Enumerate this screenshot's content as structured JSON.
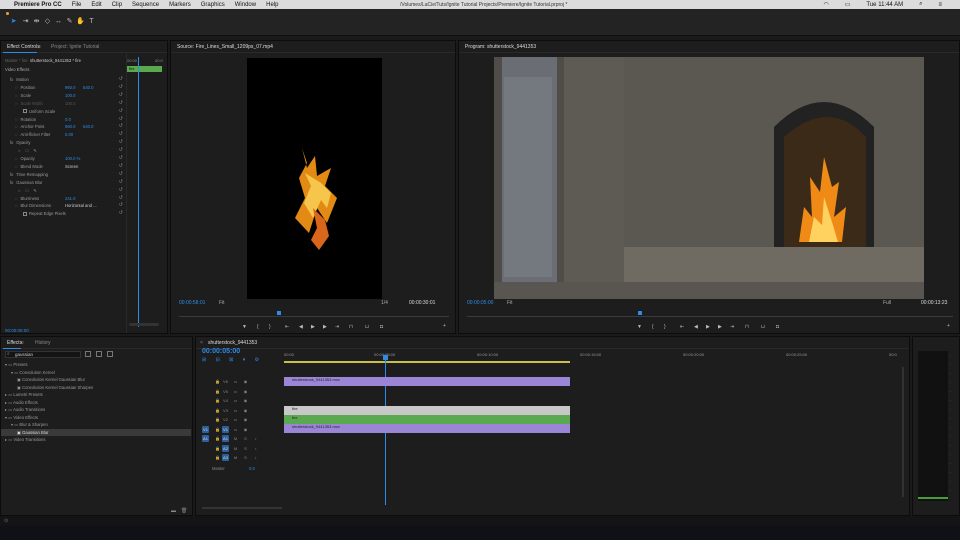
{
  "menubar": {
    "app_name": "Premiere Pro CC",
    "items": [
      "File",
      "Edit",
      "Clip",
      "Sequence",
      "Markers",
      "Graphics",
      "Window",
      "Help"
    ],
    "path": "/Volumes/LaCie/Tuts/Ignite Tutorial Projects/Premiere/Ignite Tutorial.prproj *",
    "clock": "Tue 11:44 AM"
  },
  "effect_controls": {
    "tab_active": "Effect Controls",
    "tab_project": "Project: Ignite Tutorial",
    "master": "Master * fire",
    "clip": "shutterstock_9441353 * fire",
    "ruler_start": "00:00",
    "ruler_end": "00:0",
    "clip_chip": "fire",
    "video_effects": "Video Effects",
    "rows": [
      {
        "label": "Motion",
        "indent": 1
      },
      {
        "label": "Position",
        "v1": "960.0",
        "v2": "540.0",
        "indent": 2
      },
      {
        "label": "Scale",
        "v1": "100.0",
        "indent": 2
      },
      {
        "label": "Scale Width",
        "v1": "100.0",
        "indent": 2,
        "dim": true
      },
      {
        "label": "Uniform Scale",
        "indent": 3,
        "checkbox": true
      },
      {
        "label": "Rotation",
        "v1": "0.0",
        "indent": 2
      },
      {
        "label": "Anchor Point",
        "v1": "960.0",
        "v2": "540.0",
        "indent": 2
      },
      {
        "label": "Anti-flicker Filter",
        "v1": "0.00",
        "indent": 2
      },
      {
        "label": "Opacity",
        "indent": 1
      },
      {
        "label": "",
        "indent": 2,
        "masks": true
      },
      {
        "label": "Opacity",
        "v1": "100.0 %",
        "indent": 2
      },
      {
        "label": "Blend Mode",
        "v1": "Screen",
        "indent": 2,
        "select": true
      },
      {
        "label": "Time Remapping",
        "indent": 1
      },
      {
        "label": "Gaussian Blur",
        "indent": 1
      },
      {
        "label": "",
        "indent": 2,
        "masks": true
      },
      {
        "label": "Blurriness",
        "v1": "241.0",
        "indent": 2
      },
      {
        "label": "Blur Dimensions",
        "v1": "Horizontal and ...",
        "indent": 2,
        "select": true
      },
      {
        "label": "Repeat Edge Pixels",
        "indent": 3,
        "checkbox": true
      }
    ],
    "timecode": "00:00:05:00"
  },
  "source": {
    "title": "Source: Fire_Lines_Small_1209ps_07.mp4",
    "timecode_left": "00:00:58:01",
    "fit": "Fit",
    "resolution": "1/4",
    "timecode_right": "00:00:30:01"
  },
  "program": {
    "title": "Program: shutterstock_9441353",
    "timecode_left": "00:00:05:00",
    "fit": "Fit",
    "resolution": "Full",
    "timecode_right": "00:00:13:23"
  },
  "effects": {
    "tab_active": "Effects",
    "tab_history": "History",
    "search": "gaussian",
    "tree": [
      {
        "label": "Presets",
        "indent": 0,
        "folder": true,
        "open": true
      },
      {
        "label": "Convolution Kernel",
        "indent": 1,
        "folder": true,
        "open": true
      },
      {
        "label": "Convolution Kernel Gaussian Blur",
        "indent": 2
      },
      {
        "label": "Convolution Kernel Gaussian Sharpen",
        "indent": 2
      },
      {
        "label": "Lumetri Presets",
        "indent": 0,
        "folder": true
      },
      {
        "label": "Audio Effects",
        "indent": 0,
        "folder": true
      },
      {
        "label": "Audio Transitions",
        "indent": 0,
        "folder": true
      },
      {
        "label": "Video Effects",
        "indent": 0,
        "folder": true,
        "open": true
      },
      {
        "label": "Blur & Sharpen",
        "indent": 1,
        "folder": true,
        "open": true
      },
      {
        "label": "Gaussian Blur",
        "indent": 2,
        "selected": true
      },
      {
        "label": "Video Transitions",
        "indent": 0,
        "folder": true
      }
    ]
  },
  "timeline": {
    "tab": "shutterstock_9441353",
    "timecode": "00:00:05:00",
    "ruler": [
      "00:00",
      "00:00:05:00",
      "00:00:10:00",
      "00:00:15:00",
      "00:00:20:00",
      "00:00:25:00",
      "00:0"
    ],
    "tracks": [
      "V6",
      "V5",
      "V4",
      "V3",
      "V2",
      "V1",
      "A1",
      "A2",
      "A3"
    ],
    "master": "Master",
    "master_value": "0.0",
    "clips": {
      "v5": "shutterstock_9441353.mov",
      "v2": "fire",
      "v1a": "fire",
      "v1b": "shutterstock_9441353.mov"
    }
  },
  "colors": {
    "accent": "#2d8ceb",
    "clip_purple": "#9b85d6",
    "clip_green": "#5aa84f"
  }
}
